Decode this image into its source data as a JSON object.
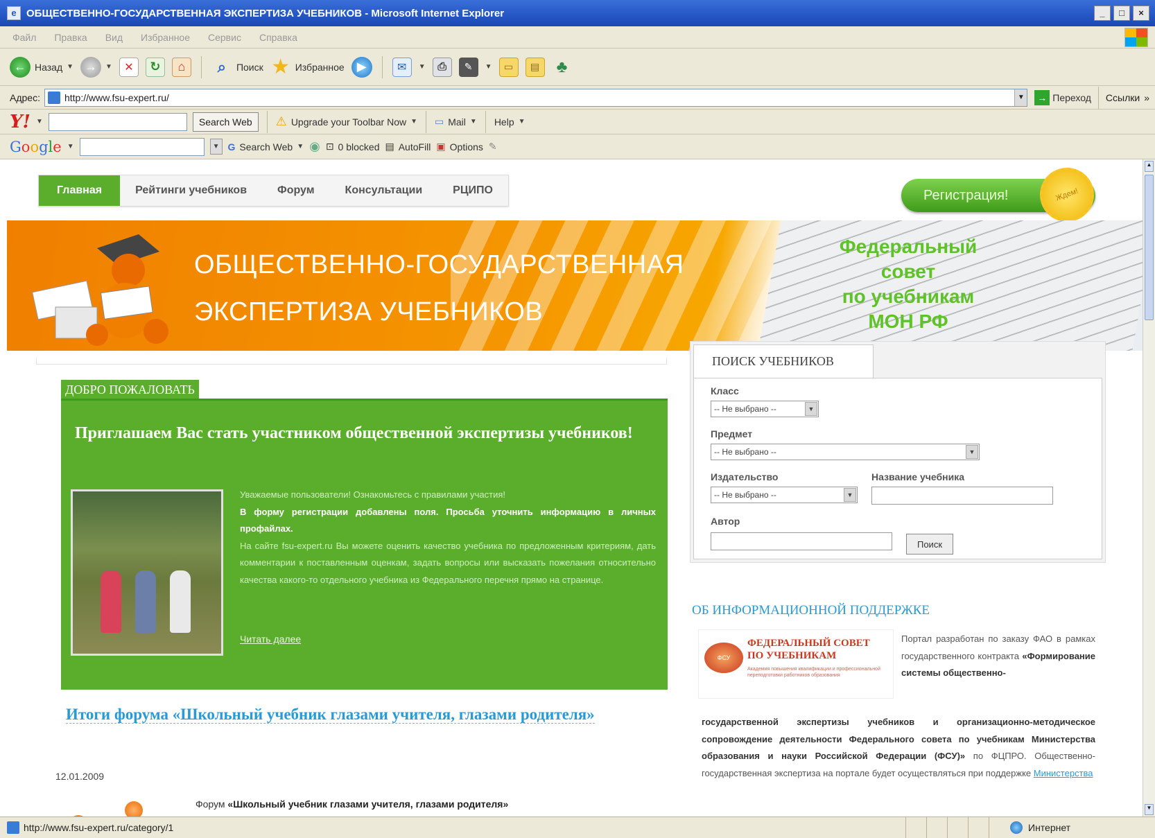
{
  "window": {
    "title": "ОБЩЕСТВЕННО-ГОСУДАРСТВЕННАЯ ЭКСПЕРТИЗА УЧЕБНИКОВ - Microsoft Internet Explorer",
    "min": "_",
    "max": "□",
    "close": "×"
  },
  "menu": [
    "Файл",
    "Правка",
    "Вид",
    "Избранное",
    "Сервис",
    "Справка"
  ],
  "toolbar": {
    "back": "Назад",
    "search": "Поиск",
    "favorites": "Избранное"
  },
  "address": {
    "label": "Адрес:",
    "url": "http://www.fsu-expert.ru/",
    "go": "Переход",
    "links": "Ссылки",
    "more": "»"
  },
  "yahoo": {
    "logo": "Y!",
    "search_btn": "Search Web",
    "upgrade": "Upgrade your Toolbar Now",
    "mail": "Mail",
    "help": "Help"
  },
  "google": {
    "search_btn": "Search Web",
    "blocked": "0 blocked",
    "autofill": "AutoFill",
    "options": "Options"
  },
  "nav": [
    "Главная",
    "Рейтинги учебников",
    "Форум",
    "Консультации",
    "РЦИПО"
  ],
  "register": {
    "label": "Регистрация!",
    "badge": "Ждем!"
  },
  "banner": {
    "line1": "ОБЩЕСТВЕННО-ГОСУДАРСТВЕННАЯ",
    "line2": "ЭКСПЕРТИЗА УЧЕБНИКОВ",
    "right_lines": [
      "Федеральный",
      "совет",
      "по учебникам",
      "МОН РФ"
    ]
  },
  "welcome": {
    "tab": "ДОБРО ПОЖАЛОВАТЬ",
    "heading": "Приглашаем Вас стать участником общественной экспертизы учебников!",
    "p1": "Уважаемые пользователи! Ознакомьтесь с правилами участия!",
    "p2": "В форму регистрации добавлены поля. Просьба уточнить информацию в личных профайлах.",
    "p3": "На сайте fsu-expert.ru Вы можете оценить качество учебника по предложенным критериям, дать комментарии к поставленным оценкам, задать вопросы или высказать пожелания относительно качества какого-то отдельного учебника из Федерального перечня прямо на странице.",
    "more": "Читать далее"
  },
  "news": {
    "title": "Итоги форума «Школьный учебник глазами учителя, глазами родителя»",
    "date": "12.01.2009",
    "snippet_prefix": "Форум ",
    "snippet_bold": "«Школьный учебник глазами учителя, глазами родителя»"
  },
  "search": {
    "tab": "ПОИСК УЧЕБНИКОВ",
    "class_label": "Класс",
    "class_value": "-- Не выбрано --",
    "subject_label": "Предмет",
    "subject_value": "-- Не выбрано --",
    "publisher_label": "Издательство",
    "publisher_value": "-- Не выбрано --",
    "title_label": "Название учебника",
    "author_label": "Автор",
    "button": "Поиск"
  },
  "info": {
    "title": "ОБ ИНФОРМАЦИОННОЙ ПОДДЕРЖКЕ",
    "logo_line1": "ФЕДЕРАЛЬНЫЙ СОВЕТ",
    "logo_line2": "ПО УЧЕБНИКАМ",
    "logo_sub": "Академия повышения квалификации и профессиональной переподготовки работников образования",
    "text_top_plain": "Портал разработан по заказу ФАО в рамках государственного контракта ",
    "text_top_bold": "«Формирование системы общественно-",
    "text_bold": "государственной экспертизы учебников и организационно-методическое сопровождение деятельности Федерального совета по учебникам Министерства образования и науки Российской Федерации (ФСУ)»",
    "text_plain": " по ФЦПРО. Общественно-государственная экспертиза на портале будет осуществляться при поддержке ",
    "text_link": "Министерства"
  },
  "status": {
    "url": "http://www.fsu-expert.ru/category/1",
    "zone": "Интернет"
  },
  "colors": {
    "green": "#5aae2c",
    "orange": "#f07f00",
    "link": "#2a9ad6"
  }
}
